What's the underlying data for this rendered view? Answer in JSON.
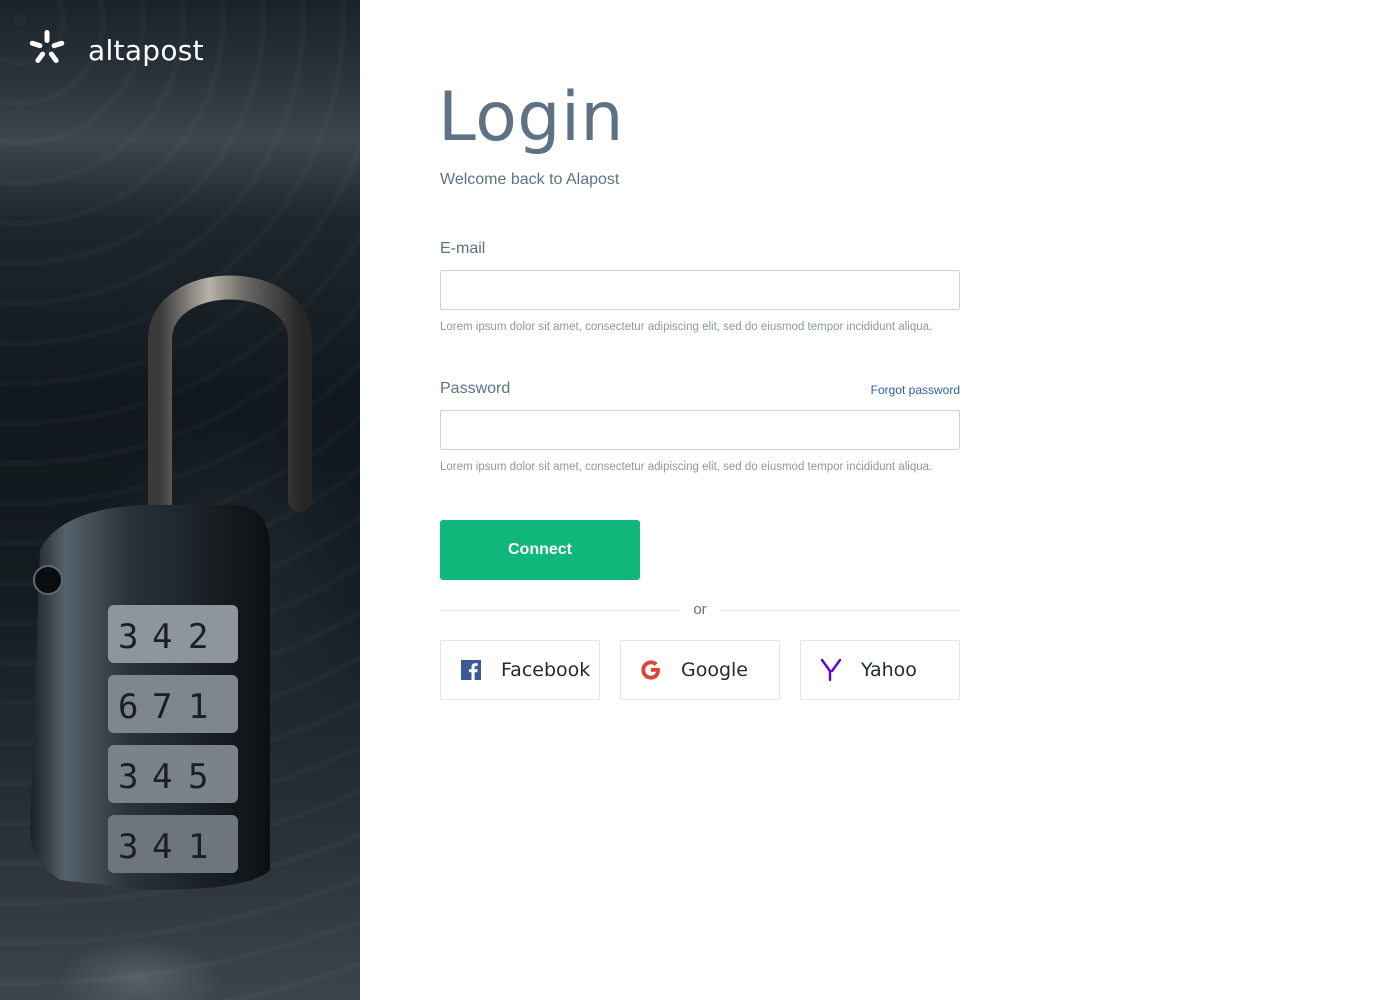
{
  "brand": {
    "name": "altapost"
  },
  "login": {
    "title": "Login",
    "subtitle": "Welcome back to Alapost",
    "email": {
      "label": "E-mail",
      "value": "",
      "placeholder": "",
      "hint": "Lorem ipsum dolor sit amet, consectetur adipiscing elit, sed do eiusmod tempor incididunt aliqua."
    },
    "password": {
      "label": "Password",
      "value": "",
      "placeholder": "",
      "forgot_label": "Forgot password",
      "hint": "Lorem ipsum dolor sit amet, consectetur adipiscing elit, sed do eiusmod tempor incididunt aliqua."
    },
    "connect_label": "Connect",
    "divider_label": "or",
    "social": [
      {
        "label": "Facebook",
        "icon": "facebook-icon",
        "color": "#3b5998"
      },
      {
        "label": "Google",
        "icon": "google-icon",
        "color": "#db4437"
      },
      {
        "label": "Yahoo",
        "icon": "yahoo-icon",
        "color": "#5f01d1"
      }
    ]
  },
  "colors": {
    "accent": "#0fb87a",
    "link": "#2d5fa6",
    "text": "#5f7284"
  }
}
